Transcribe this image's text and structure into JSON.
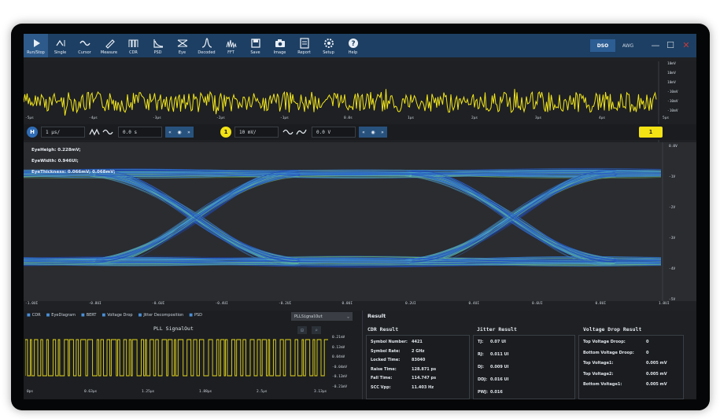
{
  "toolbar": {
    "buttons": [
      {
        "label": "Run/Stop",
        "icon": "play-icon"
      },
      {
        "label": "Single",
        "icon": "single-trigger-icon"
      },
      {
        "label": "Cursor",
        "icon": "cursor-wave-icon"
      },
      {
        "label": "Measure",
        "icon": "measure-icon"
      },
      {
        "label": "CDR",
        "icon": "cdr-icon"
      },
      {
        "label": "PSD",
        "icon": "psd-icon"
      },
      {
        "label": "Eye",
        "icon": "eye-diagram-icon"
      },
      {
        "label": "Decoded",
        "icon": "decoded-icon"
      },
      {
        "label": "FFT",
        "icon": "fft-icon"
      },
      {
        "label": "Save",
        "icon": "save-icon"
      },
      {
        "label": "Image",
        "icon": "camera-icon"
      },
      {
        "label": "Report",
        "icon": "report-icon"
      },
      {
        "label": "Setup",
        "icon": "gear-icon"
      },
      {
        "label": "Help",
        "icon": "help-icon"
      }
    ],
    "modes": [
      "DSO",
      "AWG"
    ],
    "window": {
      "minimize": "—",
      "maximize": "☐",
      "close": "✕"
    }
  },
  "overview": {
    "volt_labels": [
      "10mV",
      "10mV",
      "10mV",
      "-10mV",
      "-10mV",
      "-10mV"
    ],
    "time_ticks": [
      "-5μs",
      "-4μs",
      "-3μs",
      "-2μs",
      "-1μs",
      "0.0s",
      "1μs",
      "2μs",
      "3μs",
      "4μs",
      "5μs"
    ],
    "trace_color": "#f2e61b"
  },
  "controls": {
    "h_channel": "H",
    "timebase": "1 μs/",
    "h_offset": "0.0 s",
    "channel_num": "1",
    "vscale": "10 mV/",
    "v_offset": "0.0 V",
    "nav": [
      "«",
      "◉",
      "»"
    ],
    "nav2": [
      "«",
      "◉",
      "»"
    ],
    "ch_badge": "1"
  },
  "eye": {
    "measurements": [
      "EyeHeigh:    0.228mV;",
      "EyeWidth:    0.946UI;",
      "EyeThickness: 0.066mV; 0.068mV;"
    ],
    "volt_labels": [
      "0.0V",
      "-1V",
      "-2V",
      "-3V",
      "-4V",
      "-5V"
    ],
    "ui_ticks": [
      "-1.0UI",
      "-0.8UI",
      "-0.6UI",
      "-0.4UI",
      "-0.2UI",
      "0.0UI",
      "0.2UI",
      "0.4UI",
      "0.6UI",
      "0.8UI",
      "1.0UI"
    ]
  },
  "bottom": {
    "tabs": [
      "CDR",
      "EyeDiagram",
      "BERT",
      "Voltage Drop",
      "Jitter Decomposition",
      "PSD"
    ],
    "select_value": "PLLSignalOut",
    "pll_title": "PLL SignalOut",
    "pll_volt_labels": [
      "0.21mV",
      "0.13mV",
      "0.04mV",
      "-0.04mV",
      "-0.12mV",
      "-0.21mV"
    ],
    "pll_time_ticks": [
      "0ps",
      "0.63μs",
      "1.25μs",
      "1.88μs",
      "2.5μs",
      "3.13μs"
    ]
  },
  "result": {
    "title": "Result",
    "cdr": {
      "heading": "CDR Result",
      "rows": [
        {
          "k": "Symbol Number:",
          "v": "4421"
        },
        {
          "k": "Symbol Rate:",
          "v": "2 GHz"
        },
        {
          "k": "Locked Time:",
          "v": "83040"
        },
        {
          "k": "Raise Time:",
          "v": "128.871 ps"
        },
        {
          "k": "Fall Time:",
          "v": "114.747 ps"
        },
        {
          "k": "SCC Vpp:",
          "v": "11.403 Hz"
        }
      ]
    },
    "jitter": {
      "heading": "Jitter Result",
      "rows": [
        {
          "k": "TJ:",
          "v": "0.07 UI"
        },
        {
          "k": "RJ:",
          "v": "0.011 UI"
        },
        {
          "k": "DJ:",
          "v": "0.009 UI"
        },
        {
          "k": "DDJ:",
          "v": "0.016 UI"
        },
        {
          "k": "PWJ:",
          "v": "0.016"
        }
      ]
    },
    "voltage": {
      "heading": "Voltage Drop Result",
      "rows": [
        {
          "k": "Top Voltage Droop:",
          "v": "0"
        },
        {
          "k": "Bottom Voltage Droop:",
          "v": "0"
        },
        {
          "k": "Top Voltage1:",
          "v": "0.005 mV"
        },
        {
          "k": "Top Voltage2:",
          "v": "0.005 mV"
        },
        {
          "k": "Bottom Voltage1:",
          "v": "0.005 mV"
        }
      ]
    }
  }
}
